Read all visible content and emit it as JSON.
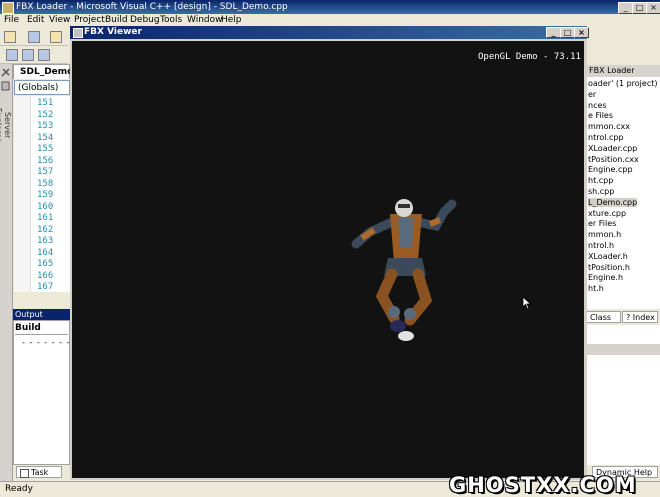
{
  "main_window": {
    "title": "FBX Loader - Microsoft Visual C++ [design] - SDL_Demo.cpp"
  },
  "menu": [
    "File",
    "Edit",
    "View",
    "Project",
    "Build",
    "Debug",
    "Tools",
    "Window",
    "Help"
  ],
  "left_panel": {
    "server_explorer_label": "Server Explorer",
    "doc_tab": "SDL_Demo.c",
    "scope_dropdown": "(Globals)",
    "line_numbers": [
      "151",
      "152",
      "153",
      "154",
      "155",
      "156",
      "157",
      "158",
      "159",
      "160",
      "161",
      "162",
      "163",
      "164",
      "165",
      "166",
      "167"
    ]
  },
  "output": {
    "header": "Output",
    "build_label": "Build",
    "dash_line": "- - - - - - - - - -",
    "task_list_tab": "Task List"
  },
  "status": {
    "text": "Ready"
  },
  "viewer": {
    "title": "FBX Viewer",
    "fps_text": "OpenGL Demo - 73.11"
  },
  "solution_explorer": {
    "header": "FBX Loader",
    "items": [
      "oader' (1 project)",
      "er",
      "nces",
      "e Files",
      "mmon.cxx",
      "ntrol.cpp",
      "XLoader.cpp",
      "tPosition.cxx",
      "Engine.cpp",
      "ht.cpp",
      "sh.cpp",
      "L_Demo.cpp",
      "xture.cpp",
      "er Files",
      "mmon.h",
      "ntrol.h",
      "XLoader.h",
      "tPosition.h",
      "Engine.h",
      "ht.h"
    ],
    "selected_index": 11,
    "class_tab": "Class ...",
    "index_tab": "Index",
    "dynamic_help_tab": "Dynamic Help"
  },
  "watermark": "GHOSTXX.COM",
  "colors": {
    "titlebar": "#0a246a",
    "viewport_bg": "#121212",
    "line_number": "#2b8fb0"
  }
}
